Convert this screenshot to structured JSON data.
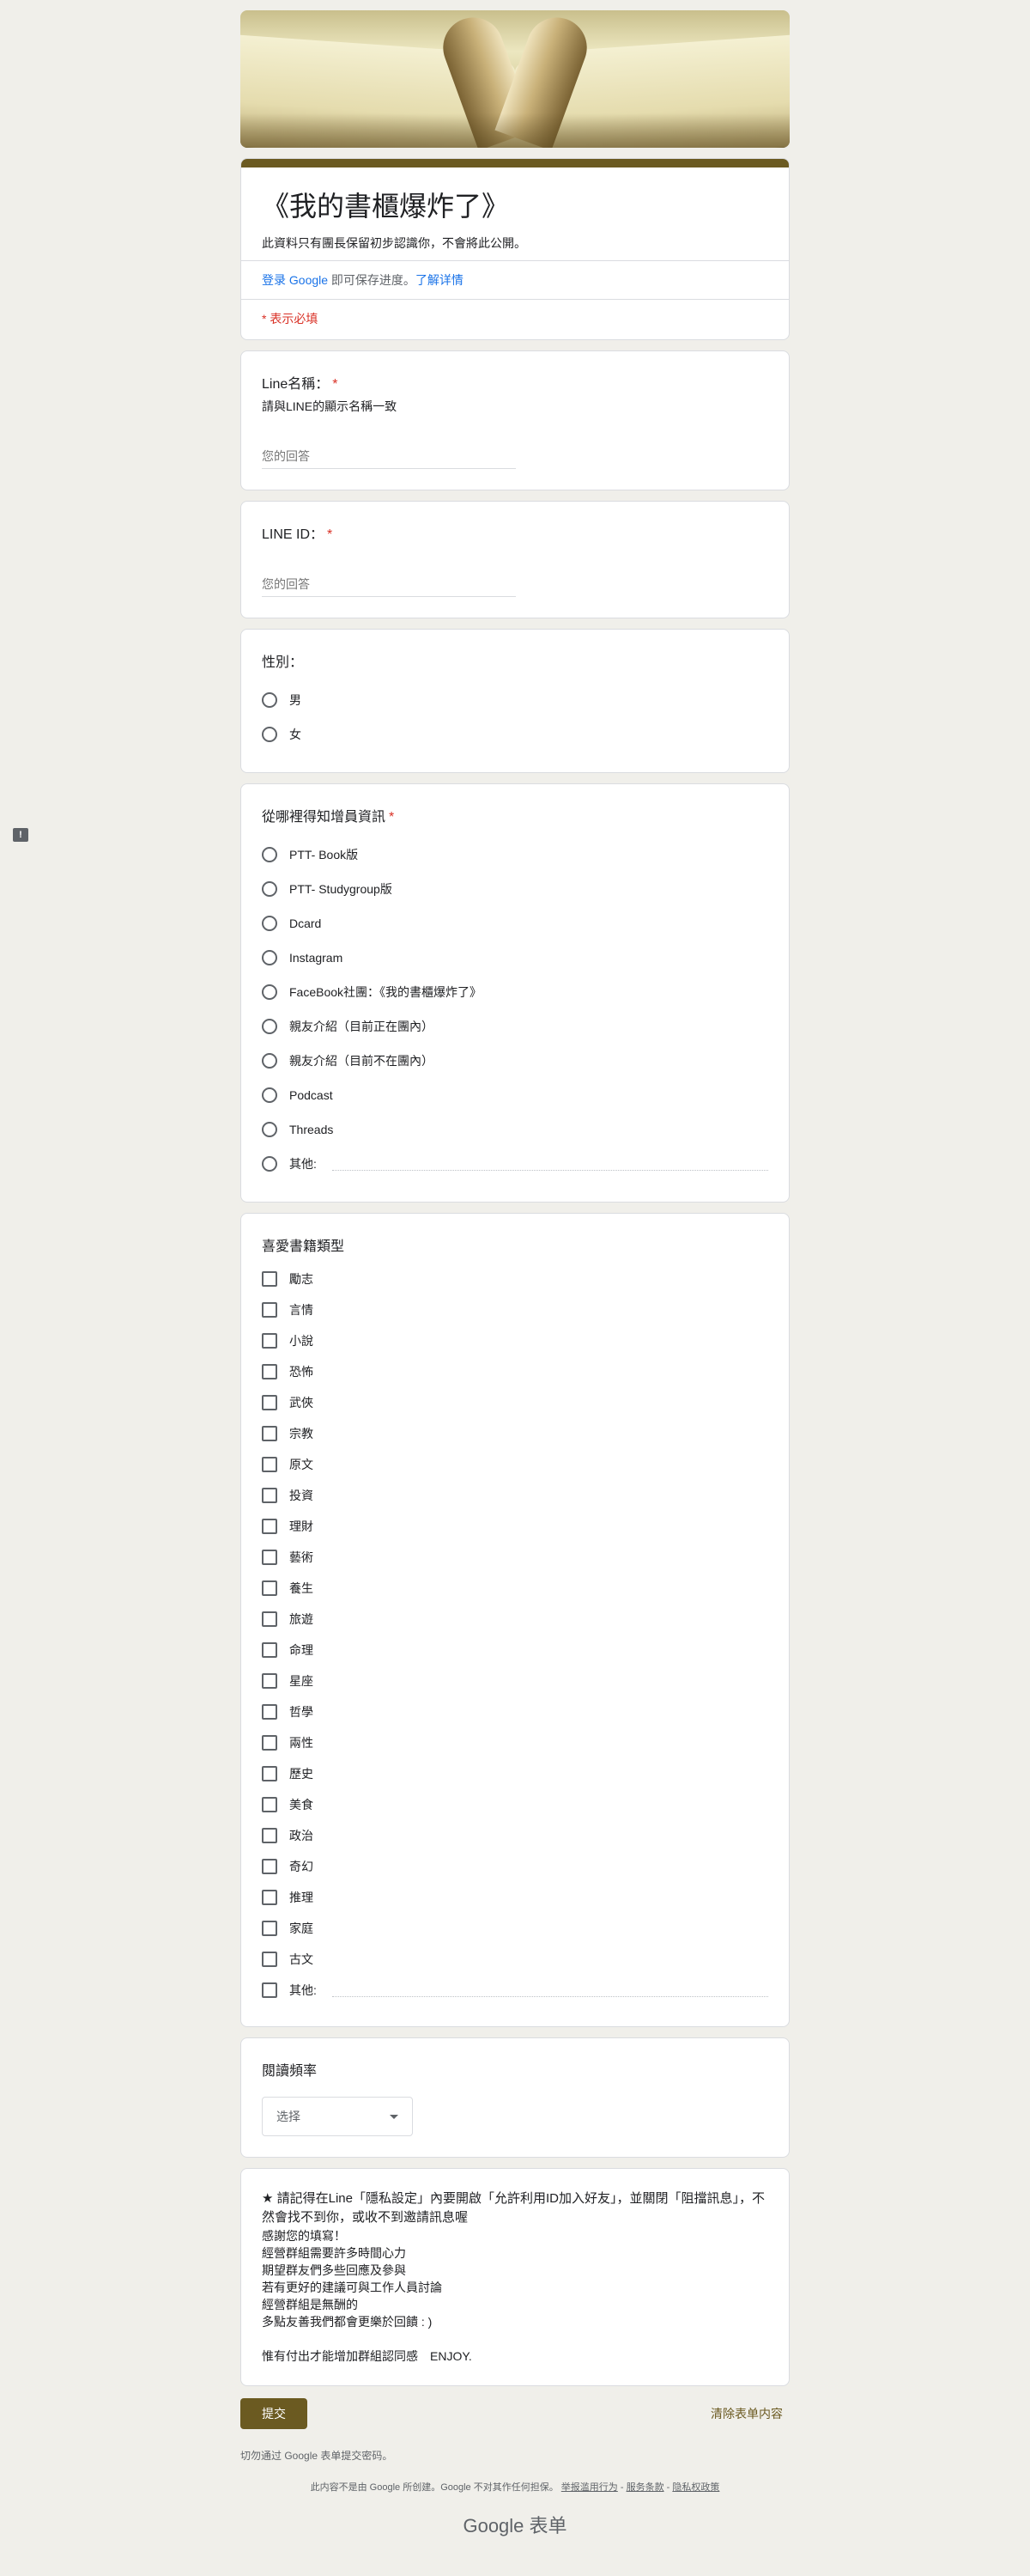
{
  "header": {
    "title": "《我的書櫃爆炸了》",
    "description": "此資料只有團長保留初步認識你，不會將此公開。",
    "login_prefix": "登录 Google",
    "login_middle": " 即可保存进度。",
    "learn_more": "了解详情",
    "required_note": "* 表示必填"
  },
  "q_line_name": {
    "title": "Line名稱：",
    "required": "*",
    "help": "請與LINE的顯示名稱一致",
    "placeholder": "您的回答"
  },
  "q_line_id": {
    "title": "LINE ID：",
    "required": "*",
    "placeholder": "您的回答"
  },
  "q_gender": {
    "title": "性別：",
    "options": [
      "男",
      "女"
    ]
  },
  "q_source": {
    "title": "從哪裡得知增員資訊",
    "required": "*",
    "options": [
      "PTT- Book版",
      "PTT- Studygroup版",
      "Dcard",
      "Instagram",
      "FaceBook社團：《我的書櫃爆炸了》",
      "親友介紹（目前正在團內）",
      "親友介紹（目前不在團內）",
      "Podcast",
      "Threads"
    ],
    "other_label": "其他:"
  },
  "q_genres": {
    "title": "喜愛書籍類型",
    "options": [
      "勵志",
      "言情",
      "小說",
      "恐怖",
      "武俠",
      "宗教",
      "原文",
      "投資",
      "理財",
      "藝術",
      "養生",
      "旅遊",
      "命理",
      "星座",
      "哲學",
      "兩性",
      "歷史",
      "美食",
      "政治",
      "奇幻",
      "推理",
      "家庭",
      "古文"
    ],
    "other_label": "其他:"
  },
  "q_frequency": {
    "title": "閱讀頻率",
    "select_value": "选择"
  },
  "notes": {
    "line1": "★ 請記得在Line「隱私設定」內要開啟「允許利用ID加入好友」，並關閉「阻擋訊息」，不然會找不到你，或收不到邀請訊息喔",
    "line2": "感謝您的填寫！",
    "line3": "經營群組需要許多時間心力",
    "line4": "期望群友們多些回應及參與",
    "line5": "若有更好的建議可與工作人員討論",
    "line6": "經營群組是無酬的",
    "line7": "多點友善我們都會更樂於回饋 : )",
    "line8": "惟有付出才能增加群組認同感　ENJOY."
  },
  "footer": {
    "submit": "提交",
    "clear": "清除表单内容",
    "password_note": "切勿通过 Google 表单提交密码。",
    "disclaimer": "此内容不是由 Google 所创建。Google 不对其作任何担保。",
    "report": "举报滥用行为",
    "terms": "服务条款",
    "privacy": "隐私权政策",
    "sep": " - ",
    "logo": "Google 表单"
  },
  "colors": {
    "accent": "#6b5a21",
    "background": "#f0efea",
    "required": "#d93025",
    "link": "#1a73e8"
  },
  "icons": {
    "report": "report-icon"
  }
}
